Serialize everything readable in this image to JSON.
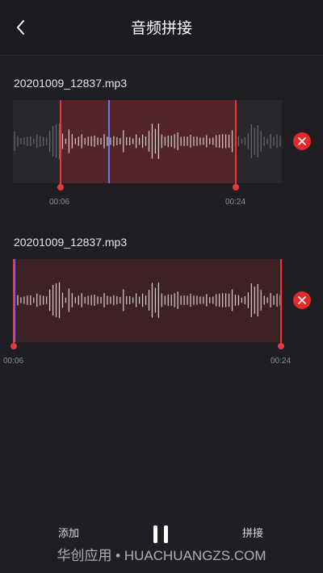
{
  "header": {
    "title": "音频拼接",
    "back_icon": "chevron-left-icon"
  },
  "clips": [
    {
      "file_name": "20201009_12837.mp3",
      "start_time": "00:06",
      "end_time": "00:24",
      "selection": "partial",
      "delete_icon": "close-icon"
    },
    {
      "file_name": "20201009_12837.mp3",
      "start_time": "00:06",
      "end_time": "00:24",
      "selection": "full",
      "delete_icon": "close-icon"
    }
  ],
  "footer": {
    "add_label": "添加",
    "pause_icon": "pause-icon",
    "splice_label": "拼接"
  },
  "watermark": "华创应用 • HUACHUANGZS.COM",
  "colors": {
    "background": "#1f1e22",
    "selection": "#3d2124",
    "marker": "#e33b3b",
    "playhead": "#6f73e8",
    "delete": "#e22a2a"
  }
}
